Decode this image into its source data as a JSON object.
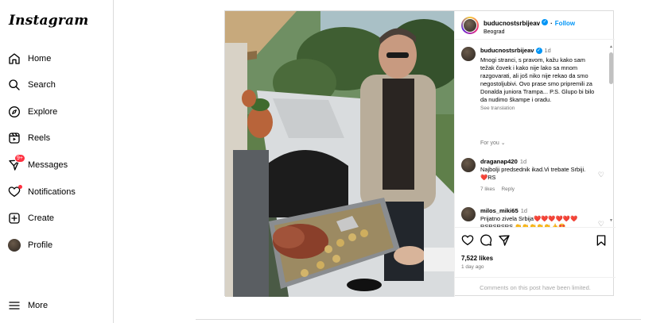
{
  "app": {
    "logo": "Instagram"
  },
  "sidebar": {
    "items": [
      {
        "label": "Home",
        "icon": "home-icon"
      },
      {
        "label": "Search",
        "icon": "search-icon"
      },
      {
        "label": "Explore",
        "icon": "compass-icon"
      },
      {
        "label": "Reels",
        "icon": "reels-icon"
      },
      {
        "label": "Messages",
        "icon": "messenger-icon",
        "badge": "9+"
      },
      {
        "label": "Notifications",
        "icon": "heart-icon"
      },
      {
        "label": "Create",
        "icon": "plus-square-icon"
      },
      {
        "label": "Profile",
        "icon": "avatar"
      }
    ],
    "more": "More"
  },
  "post": {
    "username": "buducnostsrbijeav",
    "follow": "Follow",
    "location": "Beograd",
    "caption": {
      "username": "buducnostsrbijeav",
      "time": "1d",
      "text": "Mnogi stranci, s pravom, kažu kako sam težak čovek i kako nije lako sa mnom razgovarati, ali još niko nije rekao da smo negostoljubivi. Ovo prase smo pripremili za Donalda juniora Trampa... P.S. Glupo bi bilo da nudimo škampe i oradu.",
      "see_translation": "See translation"
    },
    "for_you": "For you",
    "comments": [
      {
        "username": "draganap420",
        "time": "1d",
        "text": "Najbolji predsednik ikad.Vi trebate Srbiji. ❤️RS",
        "likes": "7 likes",
        "reply": "Reply"
      },
      {
        "username": "milos_miki65",
        "time": "1d",
        "text": "Prijatno zivela Srbija❤️❤️❤️❤️❤️❤️ RSRSRSRS 👏👏👏👏👏👍😍"
      }
    ],
    "likes_count": "7,522 likes",
    "time_ago": "1 day ago",
    "limited": "Comments on this post have been limited."
  },
  "colors": {
    "accent": "#0095f6",
    "badge": "#ff3040",
    "border": "#dbdbdb"
  }
}
